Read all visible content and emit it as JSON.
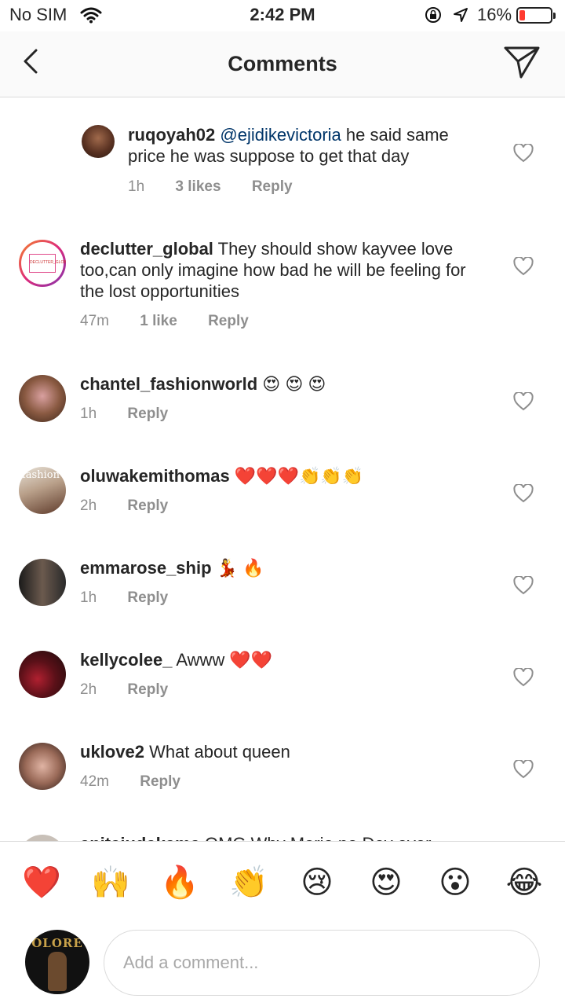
{
  "status_bar": {
    "carrier": "No SIM",
    "time": "2:42 PM",
    "battery": "16%",
    "battery_level": 0.16
  },
  "header": {
    "title": "Comments"
  },
  "comments": [
    {
      "user": "ruqoyah02",
      "mention": "@ejidikevictoria",
      "text": "he said same price he was suppose to get that day",
      "time": "1h",
      "likes": "3 likes",
      "reply": "Reply"
    },
    {
      "user": "declutter_global",
      "text": "They should show kayvee love too,can only imagine how bad he will be feeling for the lost opportunities",
      "time": "47m",
      "likes": "1 like",
      "reply": "Reply",
      "avatar_text": "DECLUTTER_GLOBAL"
    },
    {
      "user": "chantel_fashionworld",
      "text": "😍 😍 😍",
      "time": "1h",
      "reply": "Reply"
    },
    {
      "user": "oluwakemithomas",
      "text": "❤️❤️❤️👏👏👏",
      "time": "2h",
      "reply": "Reply",
      "avatar_text": "fashion"
    },
    {
      "user": "emmarose_ship",
      "text": "💃 🔥",
      "time": "1h",
      "reply": "Reply"
    },
    {
      "user": "kellycolee_",
      "text": "Awww ❤️❤️",
      "time": "2h",
      "reply": "Reply"
    },
    {
      "user": "uklove2",
      "text": "What about queen",
      "time": "42m",
      "reply": "Reply"
    },
    {
      "user": "anitaiudakama",
      "text": "OMG Why Mario no Dey ever"
    }
  ],
  "emoji_bar": [
    "❤️",
    "🙌",
    "🔥",
    "👏",
    "😢",
    "😍",
    "😮",
    "😂"
  ],
  "composer": {
    "placeholder": "Add a comment...",
    "avatar_text": "OLORE"
  },
  "colors": {
    "mention": "#003569",
    "battery_low": "#ff3b30",
    "meta_text": "#8e8e8e"
  }
}
